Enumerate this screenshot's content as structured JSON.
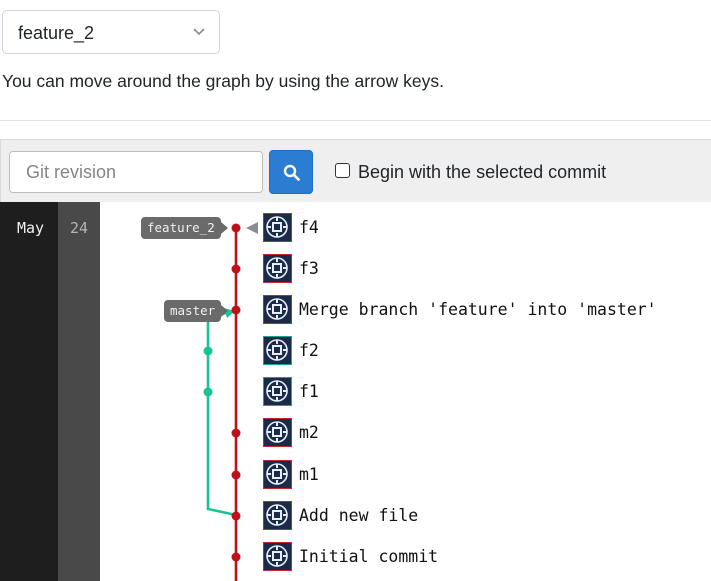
{
  "branch_select": {
    "value": "feature_2",
    "icon": "chevron-down-icon"
  },
  "hint": "You can move around the graph by using the arrow keys.",
  "toolbar": {
    "revision_placeholder": "Git revision",
    "search_icon": "search-icon",
    "begin_label": "Begin with the selected commit",
    "begin_checked": false
  },
  "dates": {
    "month": "May",
    "day": "24"
  },
  "refs": {
    "feature_2": "feature_2",
    "master": "master"
  },
  "colors": {
    "main_line": "#c0101a",
    "merge_line": "#17c494",
    "accent": "#2b7cd3"
  },
  "commits": [
    {
      "message": "f4",
      "avatar": "red"
    },
    {
      "message": "f3",
      "avatar": "red"
    },
    {
      "message": "Merge branch 'feature' into 'master'",
      "avatar": "red"
    },
    {
      "message": "f2",
      "avatar": "teal"
    },
    {
      "message": "f1",
      "avatar": "teal"
    },
    {
      "message": "m2",
      "avatar": "red"
    },
    {
      "message": "m1",
      "avatar": "red"
    },
    {
      "message": "Add new file",
      "avatar": "red"
    },
    {
      "message": "Initial commit",
      "avatar": "red"
    }
  ]
}
